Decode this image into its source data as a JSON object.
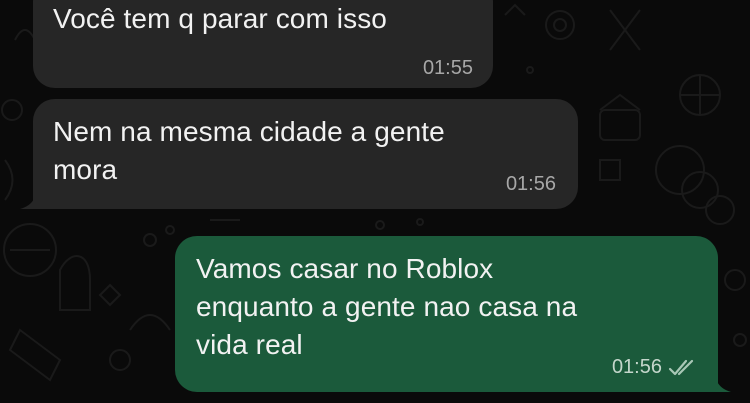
{
  "messages": [
    {
      "direction": "incoming",
      "text": "Você tem q parar com isso",
      "time": "01:55"
    },
    {
      "direction": "incoming",
      "text": "Nem na mesma cidade a gente\nmora",
      "time": "01:56"
    },
    {
      "direction": "outgoing",
      "text": "Vamos casar no Roblox\nenquanto a gente nao casa na\nvida real",
      "time": "01:56",
      "status_icon": "double-check-icon"
    }
  ],
  "colors": {
    "background": "#0a0a0a",
    "incoming_bubble": "#262626",
    "outgoing_bubble": "#1b5a3b",
    "timestamp": "#a7a7a7"
  }
}
